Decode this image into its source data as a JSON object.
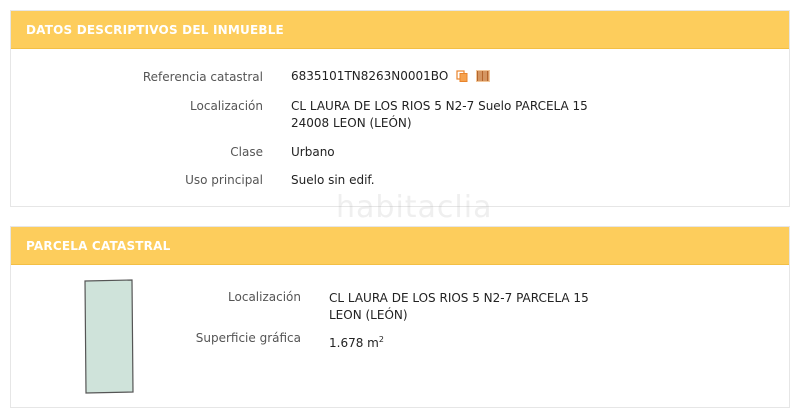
{
  "descriptive": {
    "title": "DATOS DESCRIPTIVOS DEL INMUEBLE",
    "ref_label": "Referencia catastral",
    "ref_value": "6835101TN8263N0001BO",
    "loc_label": "Localización",
    "loc_line1": "CL LAURA DE LOS RIOS 5 N2-7 Suelo PARCELA 15",
    "loc_line2": "24008 LEON (LEÓN)",
    "class_label": "Clase",
    "class_value": "Urbano",
    "use_label": "Uso principal",
    "use_value": "Suelo sin edif."
  },
  "parcel": {
    "title": "PARCELA CATASTRAL",
    "loc_label": "Localización",
    "loc_line1": "CL LAURA DE LOS RIOS 5 N2-7 PARCELA 15",
    "loc_line2": "LEON (LEÓN)",
    "surface_label": "Superficie gráfica",
    "surface_value": "1.678 m",
    "surface_unit_sup": "2"
  },
  "watermark": "habitaclia",
  "colors": {
    "header_bg": "#fdcd5c",
    "parcel_fill": "#cfe3da",
    "icon_accent": "#e8842c"
  }
}
